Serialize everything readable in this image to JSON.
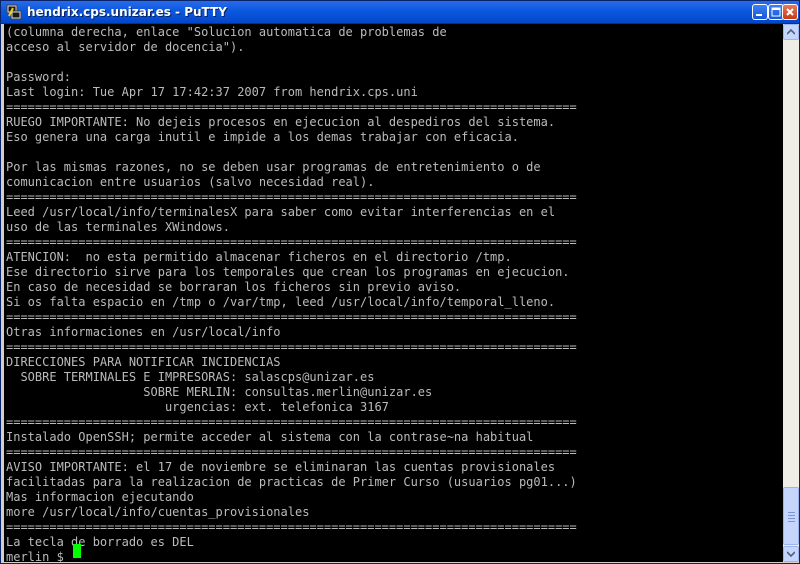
{
  "window": {
    "title": "hendrix.cps.unizar.es - PuTTY"
  },
  "icons": {
    "app": "putty-icon",
    "minimize": "minimize-icon",
    "maximize": "maximize-icon",
    "close": "close-icon",
    "scroll_up": "arrow-up-icon",
    "scroll_down": "arrow-down-icon"
  },
  "colors": {
    "titlebar": "#0a58e0",
    "terminal_background": "#000000",
    "terminal_text": "#bbbbbb",
    "cursor": "#00ff00"
  },
  "terminal": {
    "lines": [
      "(columna derecha, enlace \"Solucion automatica de problemas de",
      "acceso al servidor de docencia\").",
      "",
      "Password:",
      "Last login: Tue Apr 17 17:42:37 2007 from hendrix.cps.uni",
      "===============================================================================",
      "RUEGO IMPORTANTE: No dejeis procesos en ejecucion al despediros del sistema.",
      "Eso genera una carga inutil e impide a los demas trabajar con eficacia.",
      "",
      "Por las mismas razones, no se deben usar programas de entretenimiento o de",
      "comunicacion entre usuarios (salvo necesidad real).",
      "===============================================================================",
      "Leed /usr/local/info/terminalesX para saber como evitar interferencias en el",
      "uso de las terminales XWindows.",
      "===============================================================================",
      "ATENCION:  no esta permitido almacenar ficheros en el directorio /tmp.",
      "Ese directorio sirve para los temporales que crean los programas en ejecucion.",
      "En caso de necesidad se borraran los ficheros sin previo aviso.",
      "Si os falta espacio en /tmp o /var/tmp, leed /usr/local/info/temporal_lleno.",
      "===============================================================================",
      "Otras informaciones en /usr/local/info",
      "===============================================================================",
      "DIRECCIONES PARA NOTIFICAR INCIDENCIAS",
      "  SOBRE TERMINALES E IMPRESORAS: salascps@unizar.es",
      "                   SOBRE MERLIN: consultas.merlin@unizar.es",
      "                      urgencias: ext. telefonica 3167",
      "===============================================================================",
      "Instalado OpenSSH; permite acceder al sistema con la contrase~na habitual",
      "===============================================================================",
      "AVISO IMPORTANTE: el 17 de noviembre se eliminaran las cuentas provisionales",
      "facilitadas para la realizacion de practicas de Primer Curso (usuarios pg01...)",
      "Mas informacion ejecutando",
      "more /usr/local/info/cuentas_provisionales",
      "===============================================================================",
      "La tecla de borrado es DEL",
      "merlin_$ "
    ]
  }
}
